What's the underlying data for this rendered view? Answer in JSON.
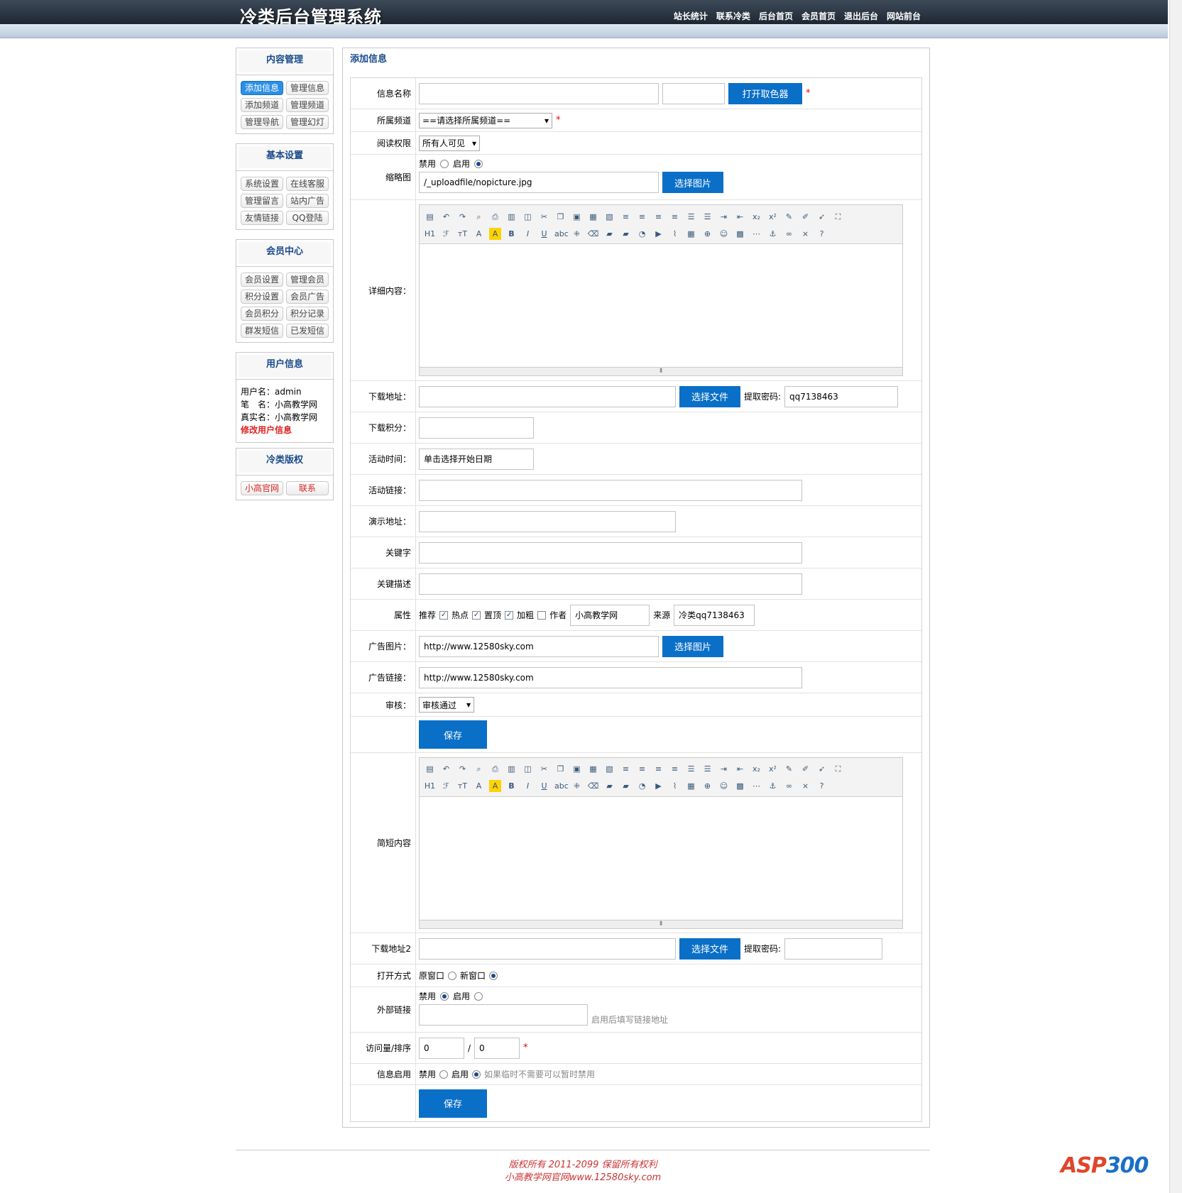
{
  "header": {
    "logo": "冷类后台管理系统",
    "nav": [
      "站长统计",
      "联系冷类",
      "后台首页",
      "会员首页",
      "退出后台",
      "网站前台"
    ]
  },
  "sidebar": {
    "content": {
      "title": "内容管理",
      "items": [
        "添加信息",
        "管理信息",
        "添加频道",
        "管理频道",
        "管理导航",
        "管理幻灯"
      ]
    },
    "basic": {
      "title": "基本设置",
      "items": [
        "系统设置",
        "在线客服",
        "管理留言",
        "站内广告",
        "友情链接",
        "QQ登陆"
      ]
    },
    "member": {
      "title": "会员中心",
      "items": [
        "会员设置",
        "管理会员",
        "积分设置",
        "会员广告",
        "会员积分",
        "积分记录",
        "群发短信",
        "已发短信"
      ]
    },
    "user": {
      "title": "用户信息",
      "username": "用户名：admin",
      "nickname": "笔　名：小高教学网",
      "realname": "真实名：小高教学网",
      "edit": "修改用户信息"
    },
    "copyright": {
      "title": "冷类版权",
      "items": [
        "小高官网",
        "联系"
      ]
    }
  },
  "main": {
    "title": "添加信息",
    "labels": {
      "name": "信息名称",
      "channel": "所属频道",
      "perm": "阅读权限",
      "thumb": "缩略图",
      "detail": "详细内容：",
      "download": "下载地址：",
      "points": "下载积分：",
      "acttime": "活动时间：",
      "actlink": "活动链接：",
      "demo": "演示地址：",
      "keywords": "关键字",
      "keydesc": "关键描述",
      "attrs": "属性",
      "adimg": "广告图片：",
      "adlink": "广告链接：",
      "audit": "审核：",
      "brief": "简短内容",
      "download2": "下载地址2",
      "openmode": "打开方式",
      "external": "外部链接",
      "visits": "访问量/排序",
      "enable": "信息启用"
    },
    "buttons": {
      "colorpicker": "打开取色器",
      "choose_image": "选择图片",
      "choose_file": "选择文件",
      "save": "保存"
    },
    "channel_select": "==请选择所属频道==",
    "perm_select": "所有人可见",
    "audit_select": "审核通过",
    "disable": "禁用",
    "enable": "启用",
    "thumb_value": "/_uploadfile/nopicture.jpg",
    "extract_label": "提取密码:",
    "extract_value": "qq7138463",
    "acttime_value": "单击选择开始日期",
    "attrs": {
      "recommend": "推荐",
      "hot": "热点",
      "top": "置顶",
      "bold": "加粗",
      "author": "作者",
      "author_value": "小高教学网",
      "source": "来源",
      "source_value": "冷类qq7138463"
    },
    "adimg_value": "http://www.12580sky.com",
    "adlink_value": "http://www.12580sky.com",
    "open_original": "原窗口",
    "open_new": "新窗口",
    "external_hint": "启用后填写链接地址",
    "visits_value": "0",
    "sort_value": "0",
    "slash": "/",
    "enable_hint": "如果临时不需要可以暂时禁用"
  },
  "footer": {
    "line1": "版权所有 2011-2099 保留所有权利",
    "line2": "小高教学网官网www.12580sky.com"
  },
  "watermark": {
    "asp": "ASP",
    "num": "300"
  }
}
